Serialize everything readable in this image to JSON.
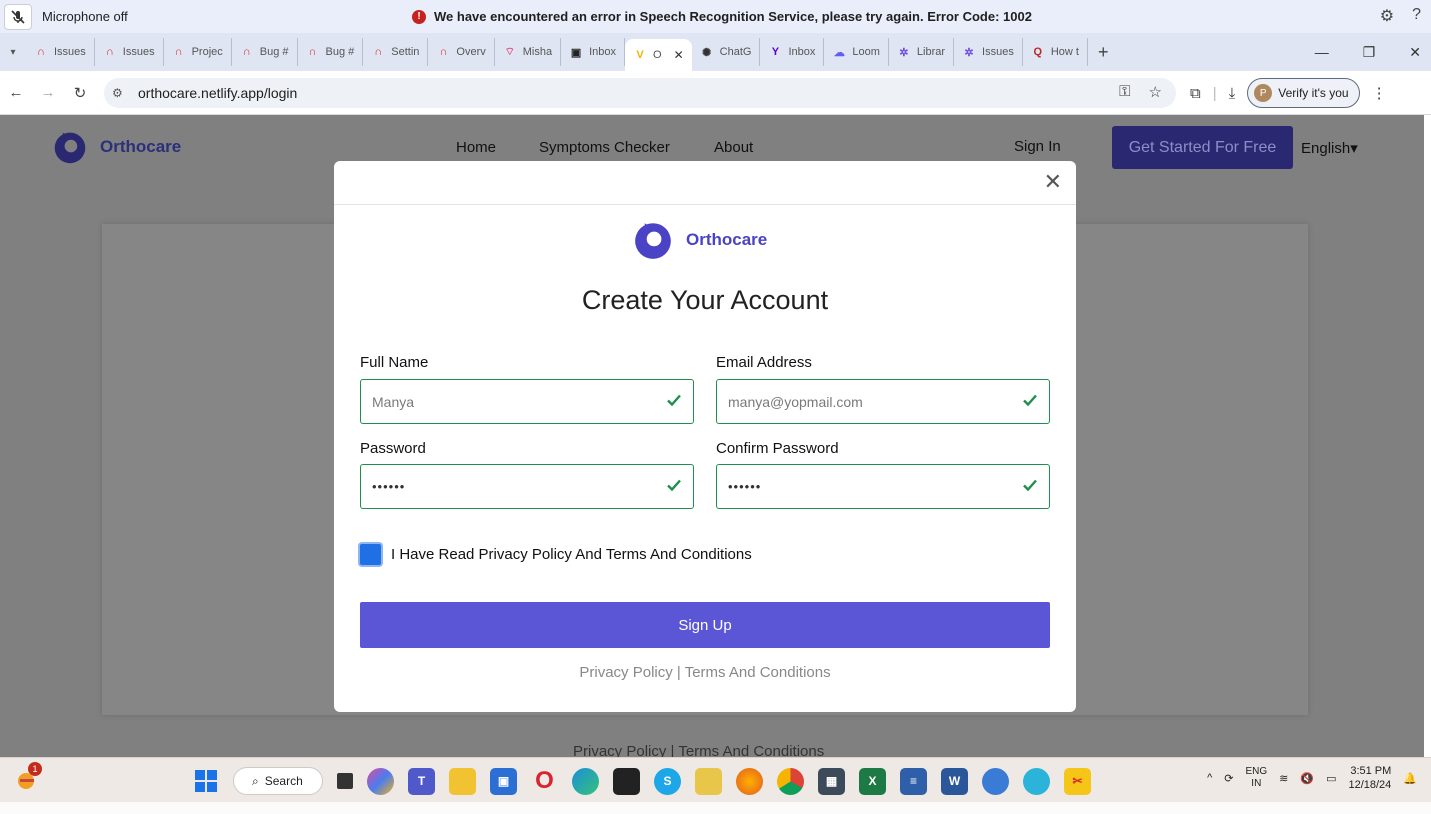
{
  "notification": {
    "mic_label": "Microphone off",
    "error_message": "We have encountered an error in Speech Recognition Service, please try again. Error Code: 1002"
  },
  "tabs": [
    {
      "label": "Issues",
      "icon": "red-arch-icon"
    },
    {
      "label": "Issues",
      "icon": "red-arch-icon"
    },
    {
      "label": "Projec",
      "icon": "red-arch-icon"
    },
    {
      "label": "Bug #",
      "icon": "red-arch-icon"
    },
    {
      "label": "Bug #",
      "icon": "red-arch-icon"
    },
    {
      "label": "Settin",
      "icon": "red-arch-icon"
    },
    {
      "label": "Overv",
      "icon": "red-arch-icon"
    },
    {
      "label": "Misha",
      "icon": "wifi-pink-icon"
    },
    {
      "label": "Inbox",
      "icon": "outlook-icon"
    },
    {
      "label": "O",
      "icon": "v-logo-icon",
      "active": true
    },
    {
      "label": "ChatG",
      "icon": "chatgpt-icon"
    },
    {
      "label": "Inbox",
      "icon": "yahoo-icon"
    },
    {
      "label": "Loom",
      "icon": "loom-icon"
    },
    {
      "label": "Librar",
      "icon": "gear-purple-icon"
    },
    {
      "label": "Issues",
      "icon": "gear-purple-icon"
    },
    {
      "label": "How t",
      "icon": "quora-icon"
    }
  ],
  "address": {
    "url": "orthocare.netlify.app/login",
    "verify_label": "Verify it's you",
    "verify_avatar": "P"
  },
  "site": {
    "brand": "Orthocare",
    "nav": [
      "Home",
      "Symptoms Checker",
      "About"
    ],
    "sign_in": "Sign In",
    "cta": "Get Started For Free",
    "language": "English",
    "footer": "Privacy Policy | Terms And Conditions"
  },
  "modal": {
    "brand": "Orthocare",
    "title": "Create Your Account",
    "full_name_label": "Full Name",
    "full_name_value": "Manya",
    "email_label": "Email Address",
    "email_value": "manya@yopmail.com",
    "password_label": "Password",
    "password_value": "••••••",
    "confirm_label": "Confirm Password",
    "confirm_value": "••••••",
    "terms_label": "I Have Read Privacy Policy And Terms And Conditions",
    "terms_checked": true,
    "signup_label": "Sign Up",
    "footer": "Privacy Policy | Terms And Conditions"
  },
  "taskbar": {
    "search_label": "Search",
    "weather_badge": "1",
    "lang_top": "ENG",
    "lang_bottom": "IN",
    "time": "3:51 PM",
    "date": "12/18/24"
  },
  "colors": {
    "brand_purple": "#4b43c5",
    "success_green": "#1f8f4e",
    "signup_bg": "#5b56d6",
    "overlay": "#808080"
  }
}
